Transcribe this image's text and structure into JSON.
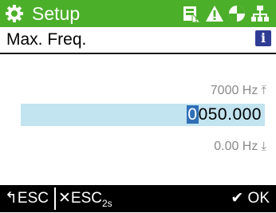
{
  "header": {
    "title": "Setup",
    "color": "#4caf2a",
    "icons": [
      "gear-icon",
      "memory-alert-icon",
      "warning-icon",
      "motor-icon",
      "network-icon"
    ]
  },
  "parameter": {
    "name": "Max. Freq.",
    "info_glyph": "i",
    "upper_limit": "7000 Hz",
    "upper_arrow": "⤒",
    "lower_limit": "0.00 Hz",
    "lower_arrow": "⤓",
    "value_cursor_digit": "0",
    "value_rest": "050.000",
    "field_color": "#c2e3f0"
  },
  "footer": {
    "back_arrow": "↰",
    "back_label": "ESC",
    "cancel_x": "✕",
    "cancel_label": "ESC",
    "cancel_sub": "2s",
    "ok_check": "✔",
    "ok_label": "OK"
  }
}
